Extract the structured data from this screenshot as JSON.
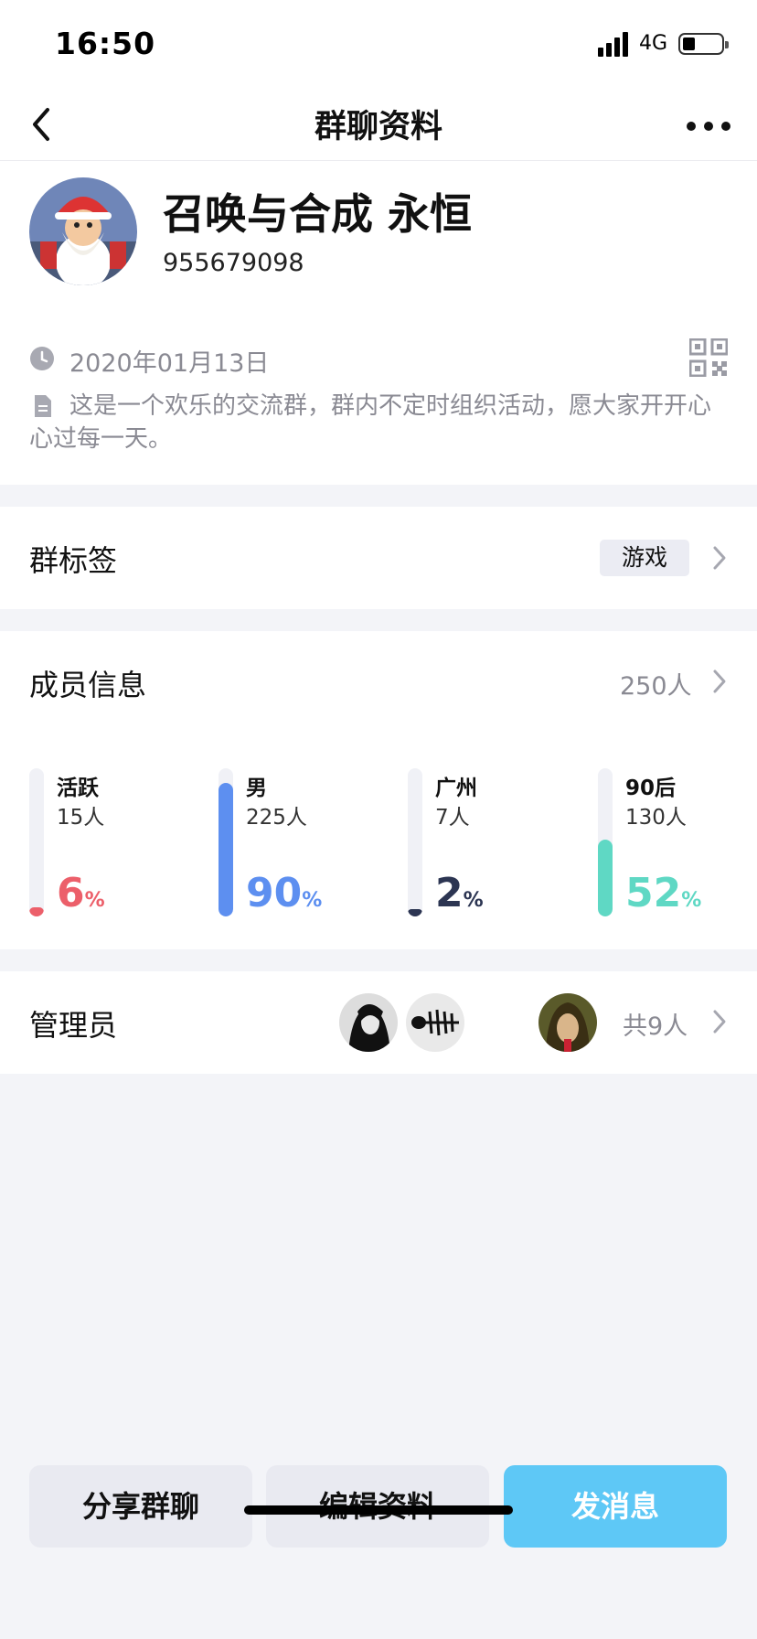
{
  "status_bar": {
    "time": "16:50",
    "network": "4G"
  },
  "nav": {
    "title": "群聊资料",
    "back_icon": "chevron-left-icon",
    "more_icon": "more-icon"
  },
  "group": {
    "name": "召唤与合成 永恒",
    "id": "955679098",
    "created_date": "2020年01月13日",
    "description": "这是一个欢乐的交流群，群内不定时组织活动，愿大家开开心心过每一天。"
  },
  "tags_row": {
    "label": "群标签",
    "tag": "游戏"
  },
  "members": {
    "label": "成员信息",
    "count": "250人",
    "stats": [
      {
        "label": "活跃",
        "count": "15人",
        "percent_value": "6",
        "percent_sign": "%",
        "fill": 0.06,
        "color": "#ec5f6a"
      },
      {
        "label": "男",
        "count": "225人",
        "percent_value": "90",
        "percent_sign": "%",
        "fill": 0.9,
        "color": "#5d8ff0"
      },
      {
        "label": "广州",
        "count": "7人",
        "percent_value": "2",
        "percent_sign": "%",
        "fill": 0.02,
        "color": "#2c3552"
      },
      {
        "label": "90后",
        "count": "130人",
        "percent_value": "52",
        "percent_sign": "%",
        "fill": 0.52,
        "color": "#5fd8c4"
      }
    ]
  },
  "admins": {
    "label": "管理员",
    "count": "共9人"
  },
  "actions": {
    "share": "分享群聊",
    "edit": "编辑资料",
    "message": "发消息"
  },
  "colors": {
    "accent": "#5ec8f6",
    "background": "#f3f4f8"
  }
}
